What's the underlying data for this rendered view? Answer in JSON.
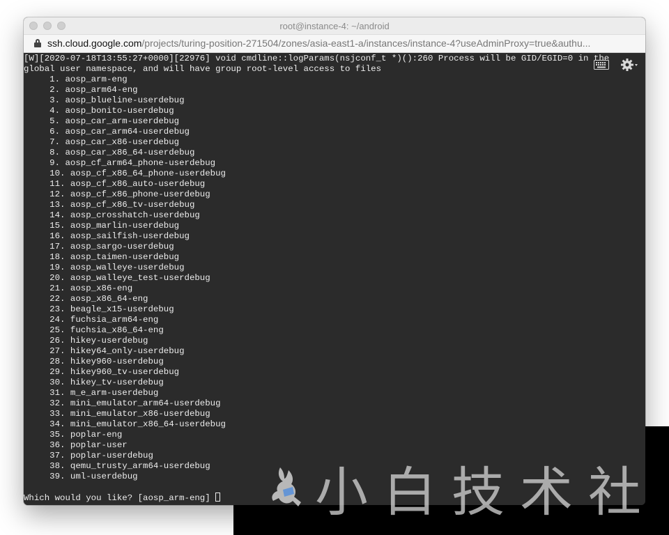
{
  "window": {
    "title": "root@instance-4: ~/android"
  },
  "address_bar": {
    "host": "ssh.cloud.google.com",
    "path": "/projects/turing-position-271504/zones/asia-east1-a/instances/instance-4?useAdminProxy=true&authu..."
  },
  "terminal": {
    "header_lines": [
      "[W][2020-07-18T13:55:27+0000][22976] void cmdline::logParams(nsjconf_t *)():260 Process will be GID/EGID=0 in the",
      "global user namespace, and will have group root-level access to files"
    ],
    "menu_items": [
      "     1. aosp_arm-eng",
      "     2. aosp_arm64-eng",
      "     3. aosp_blueline-userdebug",
      "     4. aosp_bonito-userdebug",
      "     5. aosp_car_arm-userdebug",
      "     6. aosp_car_arm64-userdebug",
      "     7. aosp_car_x86-userdebug",
      "     8. aosp_car_x86_64-userdebug",
      "     9. aosp_cf_arm64_phone-userdebug",
      "     10. aosp_cf_x86_64_phone-userdebug",
      "     11. aosp_cf_x86_auto-userdebug",
      "     12. aosp_cf_x86_phone-userdebug",
      "     13. aosp_cf_x86_tv-userdebug",
      "     14. aosp_crosshatch-userdebug",
      "     15. aosp_marlin-userdebug",
      "     16. aosp_sailfish-userdebug",
      "     17. aosp_sargo-userdebug",
      "     18. aosp_taimen-userdebug",
      "     19. aosp_walleye-userdebug",
      "     20. aosp_walleye_test-userdebug",
      "     21. aosp_x86-eng",
      "     22. aosp_x86_64-eng",
      "     23. beagle_x15-userdebug",
      "     24. fuchsia_arm64-eng",
      "     25. fuchsia_x86_64-eng",
      "     26. hikey-userdebug",
      "     27. hikey64_only-userdebug",
      "     28. hikey960-userdebug",
      "     29. hikey960_tv-userdebug",
      "     30. hikey_tv-userdebug",
      "     31. m_e_arm-userdebug",
      "     32. mini_emulator_arm64-userdebug",
      "     33. mini_emulator_x86-userdebug",
      "     34. mini_emulator_x86_64-userdebug",
      "     35. poplar-eng",
      "     36. poplar-user",
      "     37. poplar-userdebug",
      "     38. qemu_trusty_arm64-userdebug",
      "     39. uml-userdebug"
    ],
    "prompt": "Which would you like? [aosp_arm-eng] "
  },
  "icons": {
    "keyboard": "keyboard-icon",
    "settings": "gear-icon",
    "lock": "lock-icon"
  },
  "watermark": {
    "text": "小白技术社"
  }
}
